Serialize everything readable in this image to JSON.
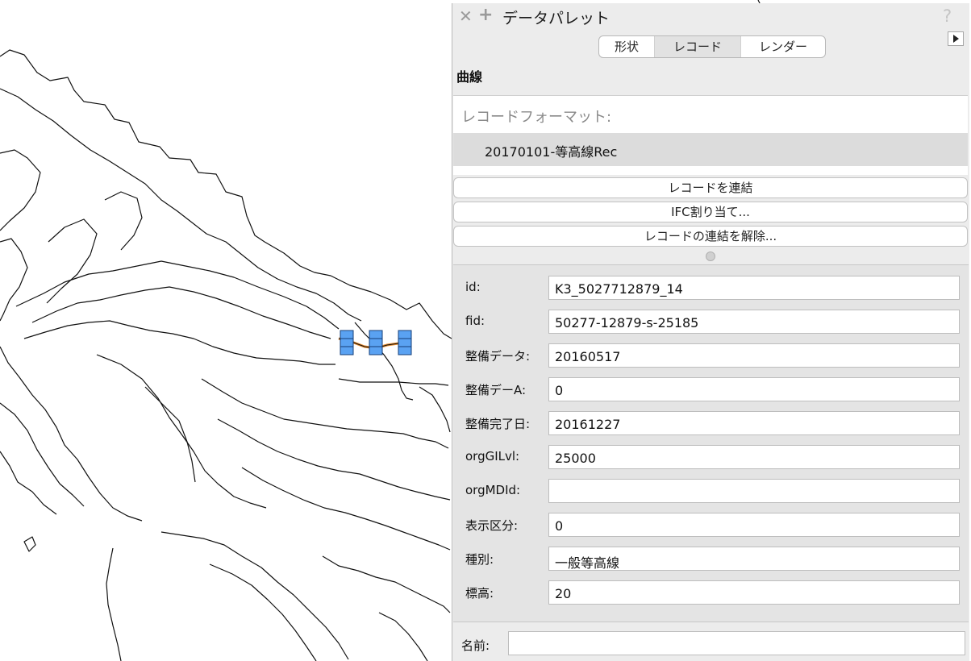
{
  "palette": {
    "title": "データパレット",
    "help": "?",
    "tabs": [
      {
        "label": "形状"
      },
      {
        "label": "レコード"
      },
      {
        "label": "レンダー"
      }
    ],
    "shape_type": "曲線",
    "record_format_label": "レコードフォーマット:",
    "record_format_item": "20170101-等高線Rec",
    "buttons": {
      "attach": "レコードを連結",
      "ifc": "IFC割り当て...",
      "detach": "レコードの連結を解除..."
    },
    "fields": [
      {
        "label": "id:",
        "value": "K3_5027712879_14"
      },
      {
        "label": "fid:",
        "value": "50277-12879-s-25185"
      },
      {
        "label": "整備データ:",
        "value": "20160517"
      },
      {
        "label": "整備デーA:",
        "value": "0"
      },
      {
        "label": "整備完了日:",
        "value": "20161227"
      },
      {
        "label": "orgGILvl:",
        "value": "25000"
      },
      {
        "label": "orgMDId:",
        "value": ""
      },
      {
        "label": "表示区分:",
        "value": "0"
      },
      {
        "label": "種別:",
        "value": "一般等高線"
      },
      {
        "label": "標高:",
        "value": "20"
      }
    ],
    "name_label": "名前:",
    "name_value": ""
  },
  "colors": {
    "selection_handle": "#5aa2f2",
    "selected_line": "#e5892a",
    "map_line": "#111111"
  }
}
